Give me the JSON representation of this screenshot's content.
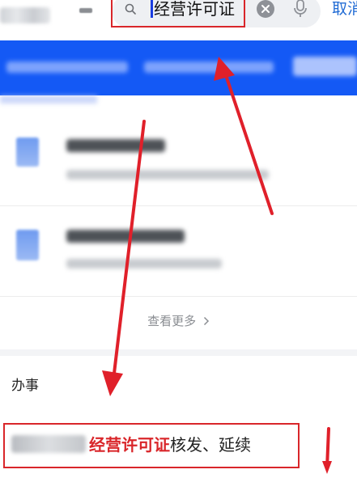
{
  "search": {
    "query": "经营许可证",
    "cancel_label": "取消"
  },
  "results_more_label": "查看更多",
  "section": {
    "title": "办事"
  },
  "service_item": {
    "highlight": "经营许可证",
    "rest": "核发、延续"
  },
  "colors": {
    "accent_blue": "#1459f5",
    "annotation_red": "#d9262a",
    "link_blue": "#1f6ad4"
  },
  "icons": [
    "search-icon",
    "clear-icon",
    "microphone-icon",
    "chevron-right-icon"
  ]
}
